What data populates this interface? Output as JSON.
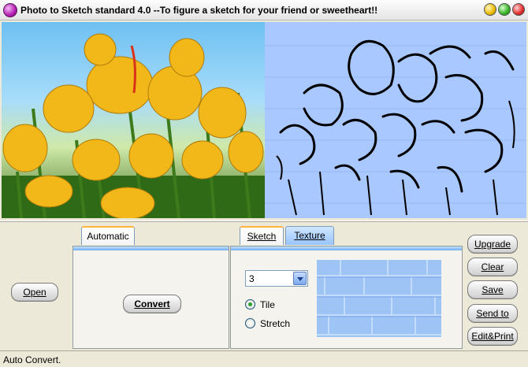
{
  "window": {
    "title": "Photo to Sketch standard 4.0 --To figure a sketch for your friend or sweetheart!!"
  },
  "buttons": {
    "open": "Open",
    "convert": "Convert",
    "upgrade": "Upgrade",
    "clear": "Clear",
    "save": "Save",
    "send_to": "Send to",
    "edit_print": "Edit&Print"
  },
  "tabs": {
    "automatic": "Automatic",
    "sketch": "Sketch",
    "texture": "Texture"
  },
  "sketch_options": {
    "level_value": "3",
    "tile_label": "Tile",
    "stretch_label": "Stretch",
    "selected": "Tile"
  },
  "status": {
    "text": "Auto Convert."
  },
  "colors": {
    "sketch_background": "#a8c8ff",
    "texture": "#9ec4f6",
    "tab_highlight": "#ffb43c"
  }
}
